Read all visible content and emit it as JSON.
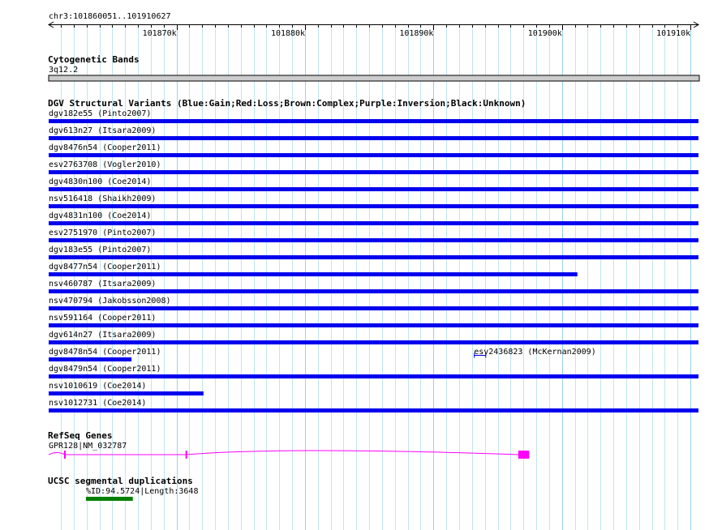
{
  "ruler": {
    "range_label": "chr3:101860051..101910627",
    "ticks": [
      {
        "pos": 101870000,
        "label": "101870k"
      },
      {
        "pos": 101880000,
        "label": "101880k"
      },
      {
        "pos": 101890000,
        "label": "101890k"
      },
      {
        "pos": 101900000,
        "label": "101900k"
      },
      {
        "pos": 101910000,
        "label": "101910k"
      }
    ],
    "start": 101860051,
    "end": 101910627
  },
  "cytoband": {
    "title": "Cytogenetic Bands",
    "band_label": "3q12.2",
    "color": "#cccccc"
  },
  "dgv": {
    "title": "DGV Structural Variants (Blue:Gain;Red:Loss;Brown:Complex;Purple:Inversion;Black:Unknown)",
    "color": "#0000ee",
    "features": [
      {
        "label": "dgv182e55 (Pinto2007)",
        "start": 101860051,
        "end": 101910627,
        "row": 0
      },
      {
        "label": "dgv613n27 (Itsara2009)",
        "start": 101860051,
        "end": 101910627,
        "row": 1
      },
      {
        "label": "dgv8476n54 (Cooper2011)",
        "start": 101860051,
        "end": 101910627,
        "row": 2
      },
      {
        "label": "esv2763708 (Vogler2010)",
        "start": 101860051,
        "end": 101910627,
        "row": 3
      },
      {
        "label": "dgv4830n100 (Coe2014)",
        "start": 101860051,
        "end": 101910627,
        "row": 4
      },
      {
        "label": "nsv516418 (Shaikh2009)",
        "start": 101860051,
        "end": 101910627,
        "row": 5
      },
      {
        "label": "dgv4831n100 (Coe2014)",
        "start": 101860051,
        "end": 101910627,
        "row": 6
      },
      {
        "label": "esv2751970 (Pinto2007)",
        "start": 101860051,
        "end": 101910627,
        "row": 7
      },
      {
        "label": "dgv183e55 (Pinto2007)",
        "start": 101860051,
        "end": 101910627,
        "row": 8
      },
      {
        "label": "dgv8477n54 (Cooper2011)",
        "start": 101860051,
        "end": 101901200,
        "row": 9
      },
      {
        "label": "nsv460787 (Itsara2009)",
        "start": 101860051,
        "end": 101910627,
        "row": 10
      },
      {
        "label": "nsv470794 (Jakobsson2008)",
        "start": 101860051,
        "end": 101910627,
        "row": 11
      },
      {
        "label": "nsv591164 (Cooper2011)",
        "start": 101860051,
        "end": 101910627,
        "row": 12
      },
      {
        "label": "dgv614n27 (Itsara2009)",
        "start": 101860051,
        "end": 101910627,
        "row": 13
      },
      {
        "label": "dgv8478n54 (Cooper2011)",
        "start": 101860051,
        "end": 101866500,
        "row": 14
      },
      {
        "label": "esv2436823 (McKernan2009)",
        "start": 101893150,
        "end": 101894100,
        "row": 14,
        "style": "thin"
      },
      {
        "label": "dgv8479n54 (Cooper2011)",
        "start": 101860051,
        "end": 101910627,
        "row": 15
      },
      {
        "label": "nsv1010619 (Coe2014)",
        "start": 101860051,
        "end": 101872100,
        "row": 16
      },
      {
        "label": "nsv1012731 (Coe2014)",
        "start": 101860051,
        "end": 101910627,
        "row": 17
      }
    ]
  },
  "refseq": {
    "title": "RefSeq Genes",
    "gene_label": "GPR128|NM_032787",
    "color": "#ff00ff",
    "start": 101860051,
    "end": 101897450,
    "exons": [
      {
        "start": 101861250,
        "end": 101861380
      },
      {
        "start": 101870700,
        "end": 101870830
      },
      {
        "start": 101896600,
        "end": 101897450
      }
    ]
  },
  "segdup": {
    "title": "UCSC segmental duplications",
    "label": "%ID:94.5724|Length:3648",
    "color": "#008000",
    "start": 101862950,
    "end": 101866600
  }
}
